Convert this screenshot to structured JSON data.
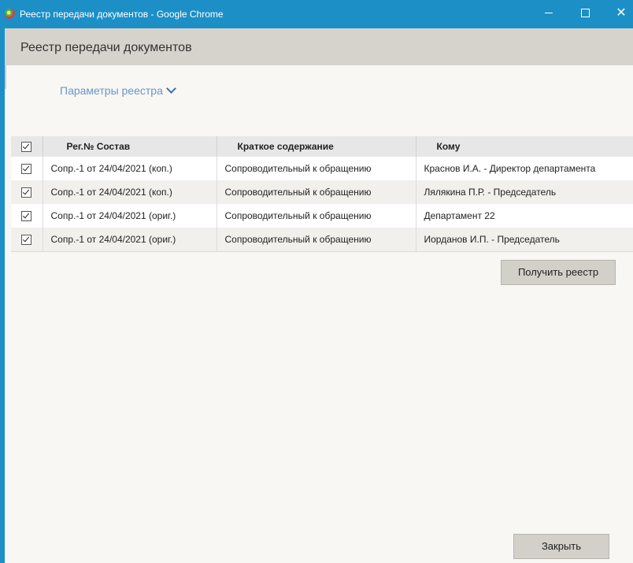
{
  "window": {
    "title": "Реестр передачи документов - Google Chrome",
    "title_bar_color": "#1c8fc6",
    "controls": {
      "minimize_icon": "minimize-icon",
      "maximize_icon": "maximize-icon",
      "close_label": "✕"
    }
  },
  "header": {
    "title": "Реестр передачи документов"
  },
  "params": {
    "label": "Параметры реестра",
    "icon": "chevron-down-icon"
  },
  "table": {
    "columns": [
      "Рег.№ Состав",
      "Краткое содержание",
      "Кому"
    ],
    "rows": [
      {
        "checked": true,
        "reg": "Сопр.-1 от 24/04/2021 (коп.)",
        "summary": "Сопроводительный к обращению",
        "to": "Краснов И.А. - Директор департамента"
      },
      {
        "checked": true,
        "reg": "Сопр.-1 от 24/04/2021 (коп.)",
        "summary": "Сопроводительный к обращению",
        "to": "Лялякина П.Р. - Председатель"
      },
      {
        "checked": true,
        "reg": "Сопр.-1 от 24/04/2021 (ориг.)",
        "summary": "Сопроводительный к обращению",
        "to": "Департамент 22"
      },
      {
        "checked": true,
        "reg": "Сопр.-1 от 24/04/2021 (ориг.)",
        "summary": "Сопроводительный к обращению",
        "to": "Иорданов И.П. - Председатель"
      }
    ]
  },
  "buttons": {
    "get_register": "Получить реестр",
    "close": "Закрыть"
  }
}
